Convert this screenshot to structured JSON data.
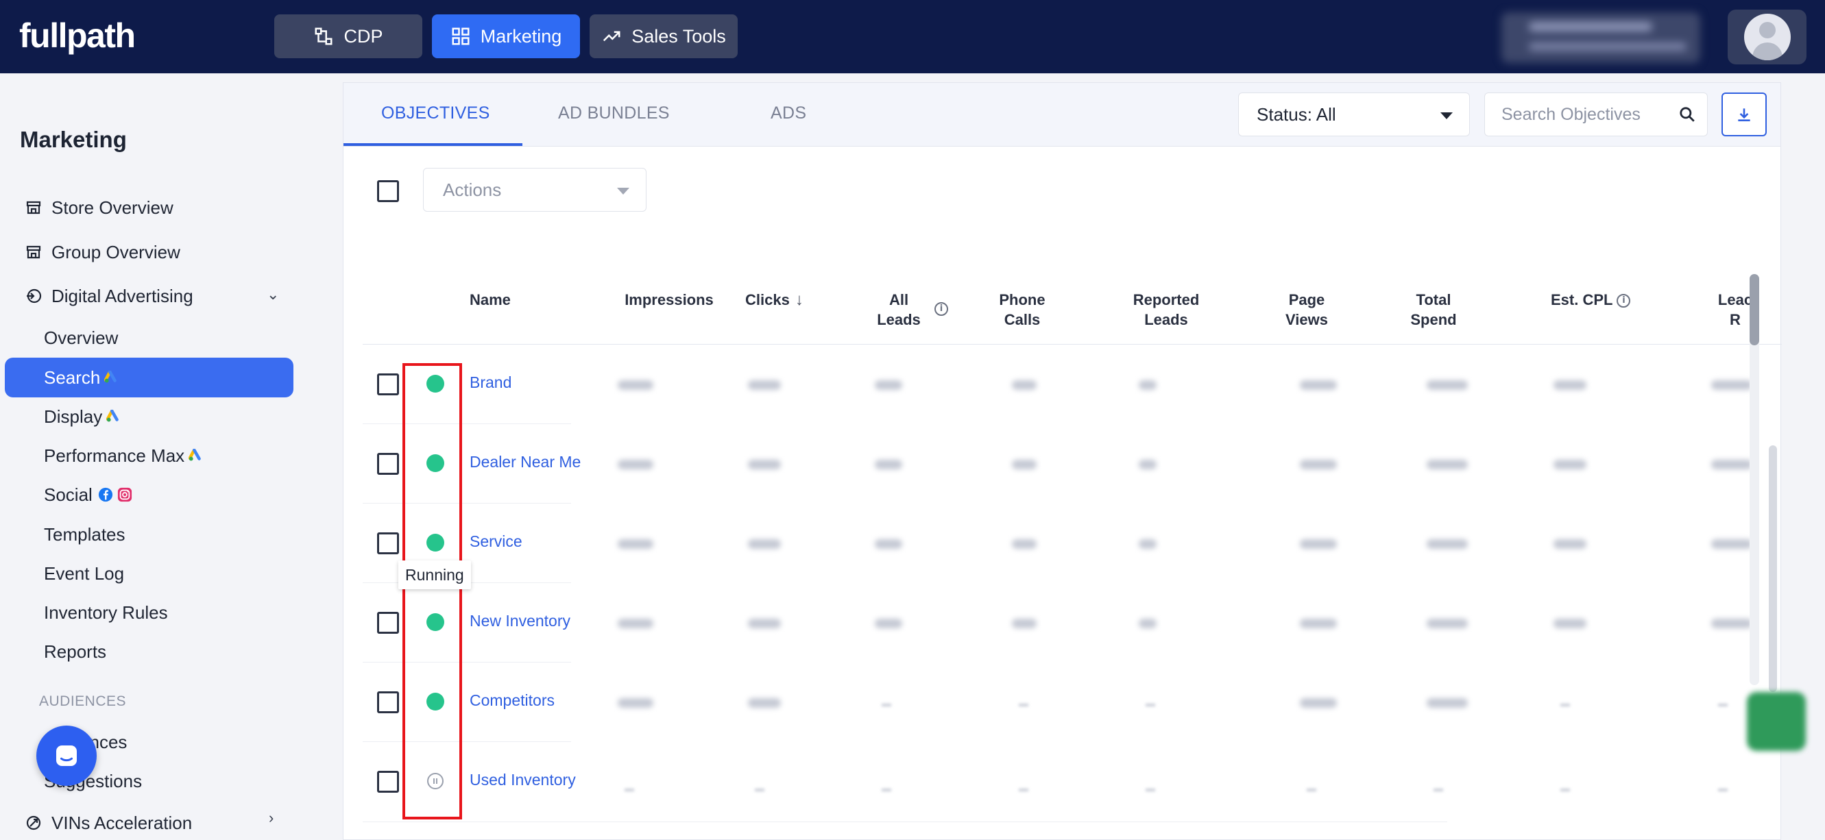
{
  "app": {
    "logo": "fullpath"
  },
  "topnav": {
    "cdp": "CDP",
    "marketing": "Marketing",
    "sales_tools": "Sales Tools"
  },
  "sidebar": {
    "title": "Marketing",
    "store_overview": "Store Overview",
    "group_overview": "Group Overview",
    "digital_advertising": "Digital Advertising",
    "sub_items": {
      "overview": "Overview",
      "search": "Search",
      "display": "Display",
      "performance_max": "Performance Max",
      "social": "Social",
      "templates": "Templates",
      "event_log": "Event Log",
      "inventory_rules": "Inventory Rules",
      "reports": "Reports"
    },
    "audiences_section": "AUDIENCES",
    "audiences": "Audiences",
    "suggestions": "Suggestions",
    "vins_acceleration": "VINs Acceleration"
  },
  "tabs": {
    "objectives": "OBJECTIVES",
    "ad_bundles": "AD BUNDLES",
    "ads": "ADS"
  },
  "filters": {
    "status_label": "Status: All",
    "search_placeholder": "Search Objectives",
    "actions_placeholder": "Actions"
  },
  "table": {
    "headers": {
      "name": "Name",
      "impressions": "Impressions",
      "clicks": "Clicks",
      "all_leads_1": "All",
      "all_leads_2": "Leads",
      "phone_1": "Phone",
      "phone_2": "Calls",
      "reported_1": "Reported",
      "reported_2": "Leads",
      "page_1": "Page",
      "page_2": "Views",
      "total_1": "Total",
      "total_2": "Spend",
      "est_cpl": "Est. CPL",
      "lead_1": "Leac",
      "lead_2": "R"
    },
    "rows": [
      {
        "name": "Brand",
        "status": "running"
      },
      {
        "name": "Dealer Near Me",
        "status": "running"
      },
      {
        "name": "Service",
        "status": "running"
      },
      {
        "name": "New Inventory",
        "status": "running"
      },
      {
        "name": "Competitors",
        "status": "running"
      },
      {
        "name": "Used Inventory",
        "status": "paused"
      }
    ]
  },
  "tooltip": "Running",
  "colors": {
    "accent": "#2f5fe0",
    "topbar": "#0e1b4a",
    "running": "#26c48c",
    "highlight": "#e8151b"
  }
}
